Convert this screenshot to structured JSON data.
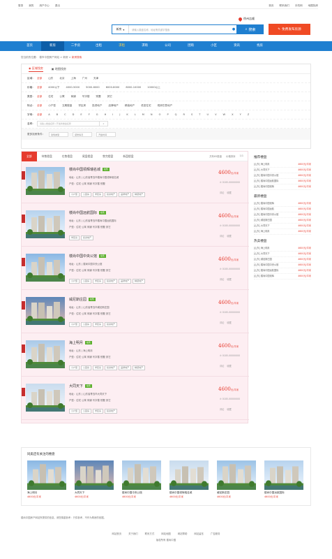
{
  "topbar": {
    "left": [
      "登录",
      "我的",
      "用户中心",
      "退出"
    ],
    "right": [
      "首页",
      "联系我们",
      "手机网",
      "地图找房"
    ]
  },
  "header": {
    "city": "徐州吉顺",
    "search_select": "新房",
    "search_placeholder": "请输入楼盘名称、地址等关键字搜索",
    "search_button": "搜索",
    "publish_button": "免费发布房源"
  },
  "nav": {
    "items": [
      "首页",
      "新房",
      "二手房",
      "出租",
      "求租",
      "求购",
      "公司",
      "团购",
      "小区",
      "资讯",
      "找房"
    ],
    "active": 1
  },
  "crumb": {
    "text": "您当前的位置：",
    "path": "楼市中国房产网站 > 新房 >",
    "current": "新房搜索"
  },
  "filter": {
    "tabs": [
      "区域找房",
      "地图找房"
    ],
    "rows": [
      {
        "key": "区域：",
        "items": [
          "全部",
          "山东",
          "北京",
          "上海",
          "广州",
          "天津"
        ]
      },
      {
        "key": "价格：",
        "items": [
          "全部",
          "4000以下",
          "4000-5000",
          "5000-6000",
          "6000-8000",
          "8000-10000",
          "10000以上"
        ]
      },
      {
        "key": "类型：",
        "items": [
          "全部",
          "住宅",
          "公寓",
          "商铺",
          "写字楼",
          "别墅",
          "其它"
        ]
      },
      {
        "key": "特点：",
        "items": [
          "全部",
          "小户型",
          "五期楼盘",
          "学区房",
          "投资地产",
          "品牌地产",
          "精装地产",
          "低密住宅",
          "现房在售地产"
        ]
      },
      {
        "key": "字母：",
        "items": [
          "全部",
          "A",
          "B",
          "C",
          "D",
          "E",
          "F",
          "G",
          "H",
          "I",
          "J",
          "K",
          "L",
          "M",
          "N",
          "O",
          "P",
          "Q",
          "R",
          "S",
          "T",
          "U",
          "V",
          "W",
          "X",
          "Y",
          "Z"
        ]
      }
    ],
    "name_label": "名称：",
    "name_placeholder": "请输入楼盘名称 / 开发商楼盘名称",
    "more_label": "更多找房条件：",
    "more_options": [
      "建筑类型",
      "装修情况",
      "开盘时间"
    ]
  },
  "list": {
    "tabs": [
      "全部",
      "待售楼盘",
      "在售楼盘",
      "尾盘楼盘",
      "售完楼盘",
      "新盘楼盘"
    ],
    "sort": [
      "共有65楼盘",
      "价格排序",
      "1/1"
    ],
    "items": [
      {
        "name": "楼尚中国领辉瑞名城",
        "badge": "在售",
        "addr": "地址：山东 | 山东省青岛市楼尚中国领辉瑞名城",
        "type": "户型：住宅 公寓 商铺 写字楼 别墅",
        "tags": [
          "小户型",
          "公园房",
          "学区房",
          "投资地产",
          "品牌地产",
          "精装地产"
        ],
        "price": "4600",
        "unit": "元/平米",
        "phone": "0185-00000000"
      },
      {
        "name": "楼尚中国远航国际",
        "badge": "在售",
        "addr": "地址：山东 | 山东省青岛市楼尚中国远航国际",
        "type": "户型：住宅 公寓 商铺 写字楼 别墅 其它",
        "tags": [
          "学区房",
          "投资地产"
        ],
        "price": "4600",
        "unit": "元/平米",
        "phone": "0185-00000000"
      },
      {
        "name": "楼尚中国中央公馆",
        "badge": "在售",
        "addr": "地址：山东 | 楼尚中国中央公馆",
        "type": "户型：住宅 公寓 商铺 写字楼 别墅 其它",
        "tags": [
          "小户型",
          "公园房",
          "学区房",
          "投资地产",
          "品牌地产",
          "精装地产"
        ],
        "price": "4600",
        "unit": "元/平米",
        "phone": "0185-00000000"
      },
      {
        "name": "威尼斯庄园",
        "badge": "在售",
        "addr": "地址：山东 | 山东省青岛市威尼斯庄园",
        "type": "户型：住宅 公寓 商铺 写字楼 别墅 其它",
        "tags": [
          "小户型",
          "公园房",
          "学区房",
          "投资地产"
        ],
        "price": "4600",
        "unit": "元/平米",
        "phone": "0185-00000000"
      },
      {
        "name": "海上明月",
        "badge": "在售",
        "addr": "地址：山东 | 海上明月",
        "type": "户型：住宅 公寓 商铺 写字楼 别墅 其它",
        "tags": [
          "小户型",
          "公园房",
          "学区房",
          "投资地产",
          "品牌地产",
          "精装地产"
        ],
        "price": "4600",
        "unit": "元/平米",
        "phone": "0185-00000000"
      },
      {
        "name": "大同天下",
        "badge": "在售",
        "addr": "地址：山东 | 山东省青岛市大同天下",
        "type": "户型：住宅 公寓 商铺 写字楼 别墅 其它",
        "tags": [
          "小户型",
          "公园房",
          "学区房",
          "投资地产"
        ],
        "price": "4600",
        "unit": "元/平米",
        "phone": "0185-00000000"
      }
    ],
    "ops": [
      "评论",
      "收藏"
    ]
  },
  "side": {
    "groups": [
      {
        "title": "推荐楼盘",
        "items": [
          [
            "[山东] 海上明月",
            "4600元/平米"
          ],
          [
            "[山东] 大同天下",
            "4600元/平米"
          ],
          [
            "[山东] 楼尚中国中央公馆",
            "4600元/平米"
          ],
          [
            "[山东] 楼尚中国远航国际",
            "4600元/平米"
          ],
          [
            "[山东] 楼尚中国领辉",
            "4600元/平米"
          ]
        ]
      },
      {
        "title": "最新楼盘",
        "items": [
          [
            "[山东] 楼尚中国领辉",
            "4600元/平米"
          ],
          [
            "[山东] 楼尚中国远航",
            "4600元/平米"
          ],
          [
            "[山东] 楼尚中国中央公馆",
            "4600元/平米"
          ],
          [
            "[山东] 威尼斯庄园",
            "4600元/平米"
          ],
          [
            "[山东] 大同天下",
            "4600元/平米"
          ],
          [
            "[山东] 海上明月",
            "4600元/平米"
          ]
        ]
      },
      {
        "title": "热卖楼盘",
        "items": [
          [
            "[山东] 海上明月",
            "4600元/平米"
          ],
          [
            "[山东] 大同天下",
            "4600元/平米"
          ],
          [
            "[山东] 威尼斯庄园",
            "4600元/平米"
          ],
          [
            "[山东] 楼尚中国中央公馆",
            "4600元/平米"
          ],
          [
            "[山东] 楼尚中国远航国际",
            "4600元/平米"
          ],
          [
            "[山东] 楼尚中国领辉",
            "4600元/平米"
          ]
        ]
      }
    ]
  },
  "like": {
    "title": "同类还有关注的楼盘",
    "items": [
      [
        "海上明月",
        "4600元/平米"
      ],
      [
        "大同天下",
        "4600元/平米"
      ],
      [
        "楼尚中国中央公馆",
        "4600元/平米"
      ],
      [
        "楼尚中国领辉瑞名城",
        "4600元/平米"
      ],
      [
        "威尼斯庄园",
        "4600元/平米"
      ],
      [
        "楼尚中国远航国际",
        "4600元/平米"
      ]
    ]
  },
  "footer": {
    "note": "楼尚中国房产网站所提供的信息，请您慎重参考：只供参考，不作为购房的依据。",
    "links": [
      "网站首页",
      "关于我们",
      "联系方式",
      "网站地图",
      "网站帮助",
      "网站留言",
      "广告服务"
    ],
    "copyright": "版权所有 楼尚中国"
  },
  "colors": {
    "blue": "#1f7fd0",
    "red": "#e63b2e",
    "pink": "#fdeef2"
  }
}
